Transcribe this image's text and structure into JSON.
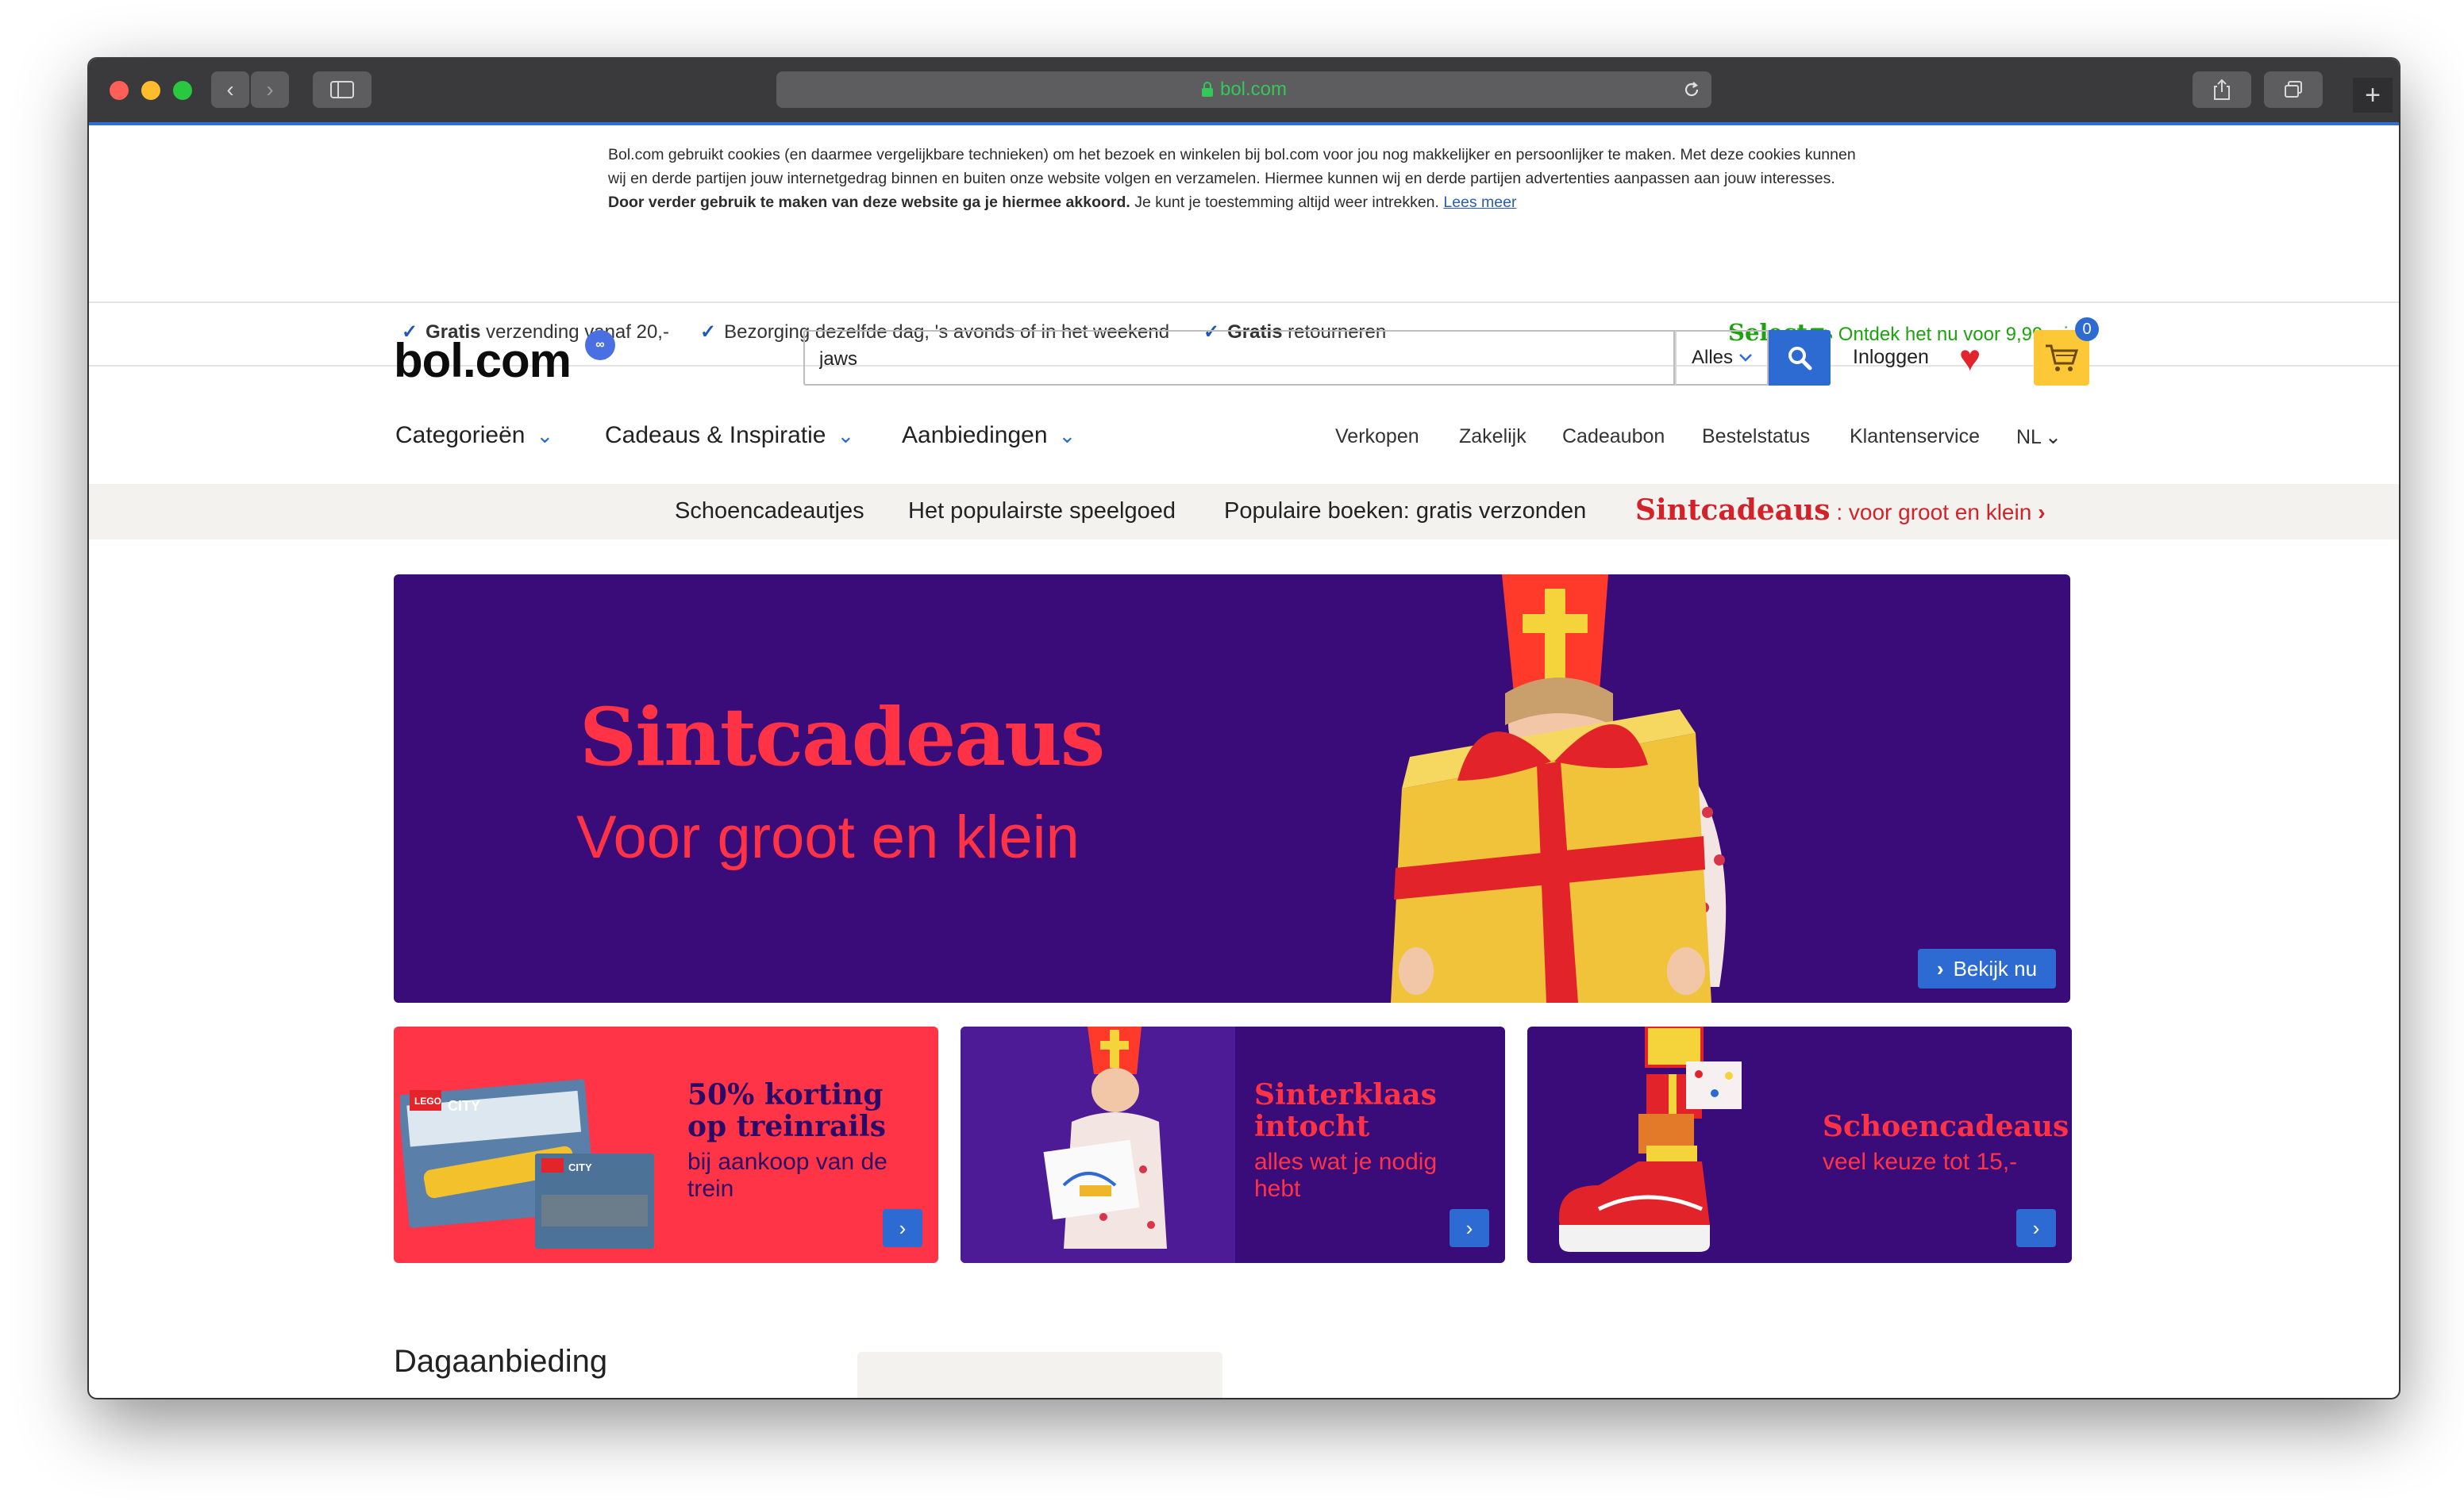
{
  "browser": {
    "url": "bol.com",
    "back_glyph": "‹",
    "forward_glyph": "›",
    "new_tab_glyph": "+"
  },
  "cookie": {
    "text_part1": "Bol.com gebruikt cookies (en daarmee vergelijkbare technieken) om het bezoek en winkelen bij bol.com voor jou nog makkelijker en persoonlijker te maken. Met deze cookies kunnen wij en derde partijen jouw internetgedrag binnen en buiten onze website volgen en verzamelen. Hiermee kunnen wij en derde partijen advertenties aanpassen aan jouw interesses. ",
    "text_bold": "Door verder gebruik te maken van deze website ga je hiermee akkoord.",
    "text_part2": " Je kunt je toestemming altijd weer intrekken. ",
    "link": "Lees meer"
  },
  "usp": {
    "item1_bold": "Gratis",
    "item1_rest": " verzending vanaf 20,-",
    "item2": "Bezorging dezelfde dag, 's avonds of in het weekend",
    "item3_bold": "Gratis",
    "item3_rest": " retourneren",
    "select_brand": "Select",
    "select_text": " Ontdek het nu voor 9,99 p.j."
  },
  "header": {
    "logo": "bol.com",
    "search_value": "jaws",
    "search_scope": "Alles",
    "login": "Inloggen",
    "cart_count": "0"
  },
  "nav": {
    "left": [
      "Categorieën",
      "Cadeaus & Inspiratie",
      "Aanbiedingen"
    ],
    "right": [
      "Verkopen",
      "Zakelijk",
      "Cadeaubon",
      "Bestelstatus",
      "Klantenservice",
      "NL"
    ]
  },
  "strip": {
    "items": [
      "Schoencadeautjes",
      "Het populairste speelgoed",
      "Populaire boeken: gratis verzonden"
    ],
    "promo_bold": "Sintcadeaus",
    "promo_rest": " : voor groot en klein"
  },
  "hero": {
    "title": "Sintcadeaus",
    "subtitle": "Voor groot en klein",
    "cta": "Bekijk nu"
  },
  "tiles": [
    {
      "title_l1": "50% korting",
      "title_l2": "op treinrails",
      "sub_l1": "bij aankoop van de",
      "sub_l2": "trein",
      "badge": "CITY"
    },
    {
      "title_l1": "Sinterklaas",
      "title_l2": "intocht",
      "sub_l1": "alles wat je nodig",
      "sub_l2": "hebt"
    },
    {
      "title_l1": "Schoencadeaus",
      "sub_l1": "veel keuze tot 15,-"
    }
  ],
  "section": {
    "title": "Dagaanbieding"
  },
  "colors": {
    "brand_blue": "#2d6bd3",
    "hero_purple": "#3a0c7a",
    "sint_red": "#ff3246",
    "select_green": "#1da30f"
  }
}
